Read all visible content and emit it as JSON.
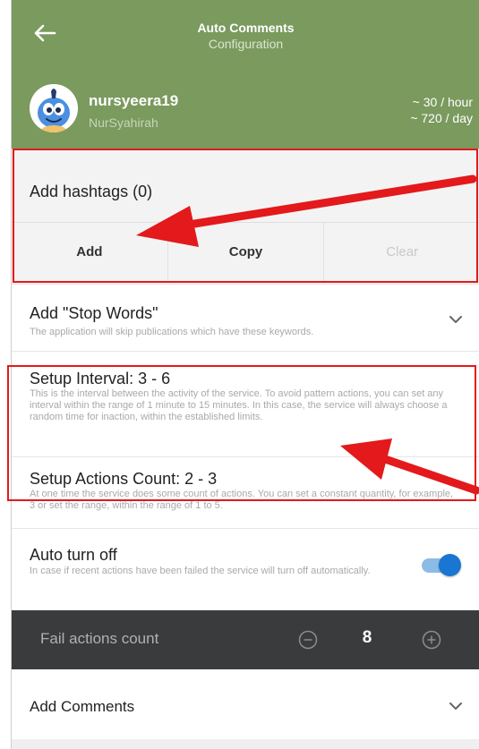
{
  "header": {
    "title": "Auto Comments",
    "subtitle": "Configuration",
    "username": "nursyeera19",
    "fullname": "NurSyahirah",
    "rate_hour": "~ 30 / hour",
    "rate_day": "~ 720 / day",
    "back_icon": "arrow-left-icon",
    "color": "#7a9a5e"
  },
  "hashtags": {
    "title": "Add hashtags (0)",
    "buttons": [
      "Add",
      "Copy",
      "Clear"
    ]
  },
  "stop_words": {
    "title": "Add \"Stop Words\"",
    "desc": "The application will skip publications which have these keywords."
  },
  "interval": {
    "title": "Setup Interval: 3 - 6",
    "desc": "This is the interval between the activity of the service. To avoid pattern actions, you can set any interval within the range of 1 minute to 15 minutes. In this case, the service will always choose a random time for inaction, within the established limits."
  },
  "actions_count": {
    "title": "Setup Actions Count: 2 - 3",
    "desc": "At one time the service does some count of actions. You can set a constant quantity, for example, 3 or set the range, within the range of 1 to 5."
  },
  "auto_off": {
    "title": "Auto turn off",
    "desc": "In case if recent actions have been failed the service will turn off automatically.",
    "enabled": true,
    "color": "#1976d2"
  },
  "fail_actions": {
    "label": "Fail actions count",
    "value": "8"
  },
  "comments": {
    "title": "Add Comments"
  },
  "annotation_color": "#e3191b"
}
